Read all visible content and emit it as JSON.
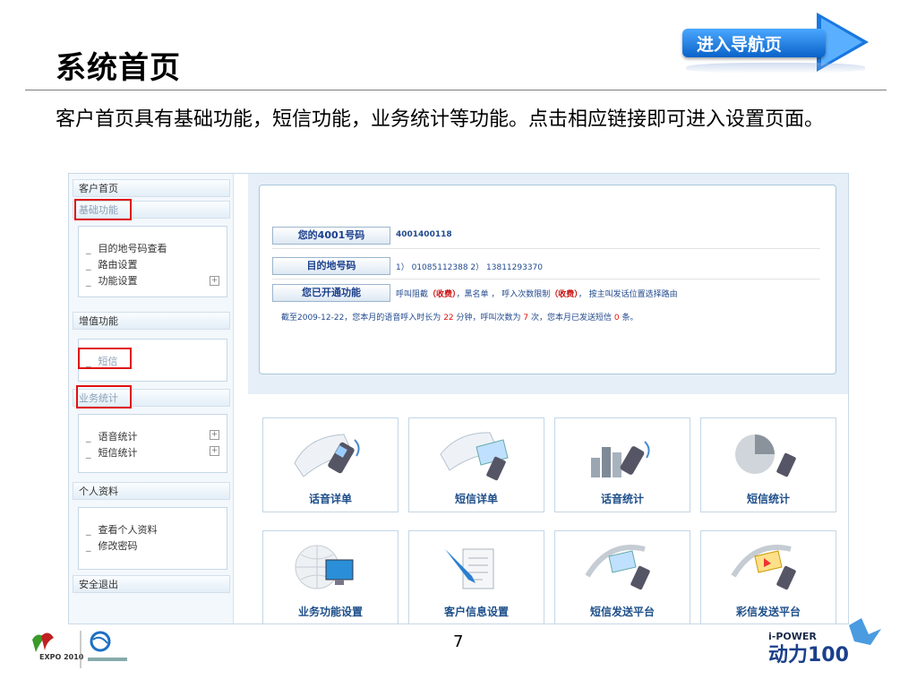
{
  "slide": {
    "title": "系统首页",
    "nav_button": "进入导航页",
    "description": "客户首页具有基础功能，短信功能，业务统计等功能。点击相应链接即可进入设置页面。",
    "page_number": "7"
  },
  "sidebar": {
    "home": "客户首页",
    "basic": "基础功能",
    "basic_items": [
      "目的地号码查看",
      "路由设置",
      "功能设置"
    ],
    "value_added": "增值功能",
    "sms": "短信",
    "stats": "业务统计",
    "stats_items": [
      "语音统计",
      "短信统计"
    ],
    "profile": "个人资料",
    "profile_items": [
      "查看个人资料",
      "修改密码"
    ],
    "logout": "安全退出"
  },
  "info": {
    "label1": "您的4001号码",
    "value1": "4001400118",
    "label2": "目的地号码",
    "value2": "1） 01085112388   2） 13811293370",
    "label3": "您已开通功能",
    "value3a": "呼叫阻截",
    "value3b": "（收费）",
    "value3c": "，黑名单 ， 呼入次数限制",
    "value3d": "（收费）",
    "value3e": "， 按主叫发话位置选择路由",
    "stat_prefix": "截至2009-12-22，您本月的语音呼入时长为",
    "minutes": "22",
    "stat_mid1": "分钟，呼叫次数为",
    "calls": "7",
    "stat_mid2": "次，您本月已发送短信",
    "sms_count": "0",
    "stat_suffix": "条。"
  },
  "tiles": [
    "话音详单",
    "短信详单",
    "话音统计",
    "短信统计",
    "业务功能设置",
    "客户信息设置",
    "短信发送平台",
    "彩信发送平台"
  ],
  "logos": {
    "right_brand": "i-POWER",
    "right_mark": "动力100",
    "left_expo": "EXPO 2010"
  },
  "colors": {
    "accent_blue": "#1a77e0",
    "highlight_red": "#e01010",
    "label_text": "#1a3f8c"
  }
}
